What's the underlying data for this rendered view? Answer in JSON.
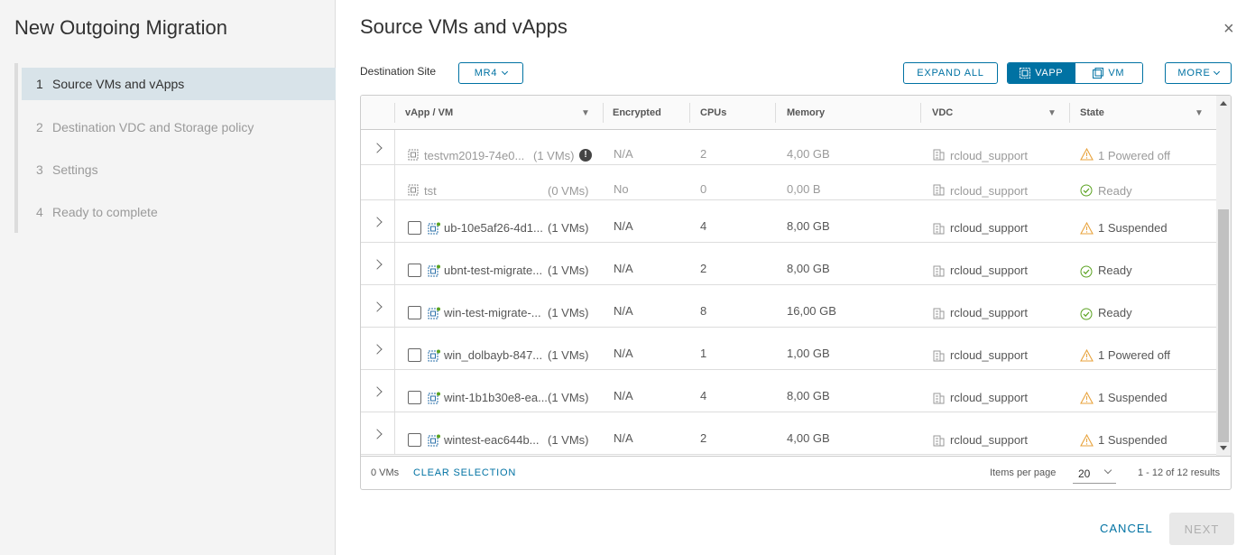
{
  "wizard": {
    "title": "New Outgoing Migration",
    "steps": [
      {
        "num": "1",
        "label": "Source VMs and vApps"
      },
      {
        "num": "2",
        "label": "Destination VDC and Storage policy"
      },
      {
        "num": "3",
        "label": "Settings"
      },
      {
        "num": "4",
        "label": "Ready to complete"
      }
    ]
  },
  "page": {
    "title": "Source VMs and vApps",
    "close": "×"
  },
  "toolbar": {
    "destination_label": "Destination Site",
    "destination_value": "MR4",
    "expand_all": "EXPAND ALL",
    "vapp": "VAPP",
    "vm": "VM",
    "more": "MORE"
  },
  "grid": {
    "columns": [
      "vApp / VM",
      "Encrypted",
      "CPUs",
      "Memory",
      "VDC",
      "State"
    ],
    "rows": [
      {
        "name": "testvm2019-74e0...",
        "count": "(1 VMs)",
        "encrypted": "N/A",
        "cpus": "2",
        "memory": "4,00 GB",
        "vdc": "rcloud_support",
        "state": "1 Powered off"
      },
      {
        "name": "tst",
        "count": "(0 VMs)",
        "encrypted": "No",
        "cpus": "0",
        "memory": "0,00 B",
        "vdc": "rcloud_support",
        "state": "Ready"
      },
      {
        "name": "ub-10e5af26-4d1...",
        "count": "(1 VMs)",
        "encrypted": "N/A",
        "cpus": "4",
        "memory": "8,00 GB",
        "vdc": "rcloud_support",
        "state": "1 Suspended"
      },
      {
        "name": "ubnt-test-migrate...",
        "count": "(1 VMs)",
        "encrypted": "N/A",
        "cpus": "2",
        "memory": "8,00 GB",
        "vdc": "rcloud_support",
        "state": "Ready"
      },
      {
        "name": "win-test-migrate-...",
        "count": "(1 VMs)",
        "encrypted": "N/A",
        "cpus": "8",
        "memory": "16,00 GB",
        "vdc": "rcloud_support",
        "state": "Ready"
      },
      {
        "name": "win_dolbayb-847...",
        "count": "(1 VMs)",
        "encrypted": "N/A",
        "cpus": "1",
        "memory": "1,00 GB",
        "vdc": "rcloud_support",
        "state": "1 Powered off"
      },
      {
        "name": "wint-1b1b30e8-ea...",
        "count": "(1 VMs)",
        "encrypted": "N/A",
        "cpus": "4",
        "memory": "8,00 GB",
        "vdc": "rcloud_support",
        "state": "1 Suspended"
      },
      {
        "name": "wintest-eac644b...",
        "count": "(1 VMs)",
        "encrypted": "N/A",
        "cpus": "2",
        "memory": "4,00 GB",
        "vdc": "rcloud_support",
        "state": "1 Suspended"
      }
    ],
    "footer": {
      "selected": "0 VMs",
      "clear": "CLEAR SELECTION",
      "items_per_page_label": "Items per page",
      "items_per_page": "20",
      "results": "1 - 12 of 12 results"
    }
  },
  "actions": {
    "cancel": "CANCEL",
    "next": "NEXT"
  },
  "colors": {
    "accent": "#0072a3",
    "warning": "#e8a33d",
    "success": "#5aa220"
  }
}
